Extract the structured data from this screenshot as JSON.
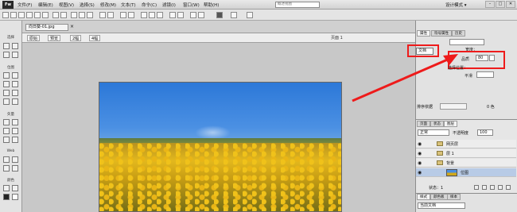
{
  "menubar": {
    "logo": "Fw",
    "items": [
      "文件(F)",
      "编辑(E)",
      "视图(V)",
      "选择(S)",
      "修改(M)",
      "文本(T)",
      "命令(C)",
      "滤镜(I)",
      "窗口(W)",
      "帮助(H)"
    ],
    "search_placeholder": "概述视图",
    "mode": "设计模式 ▾",
    "window_buttons": [
      "–",
      "□",
      "✕"
    ]
  },
  "document": {
    "tab_title": "向日葵-01.jpg",
    "tab_close": "×",
    "view_buttons": [
      "原始",
      "预览",
      "2幅",
      "4幅"
    ],
    "scene": "页面 1"
  },
  "tools": {
    "sections": [
      "选择",
      "位图",
      "矢量",
      "Web",
      "颜色"
    ]
  },
  "properties": {
    "tabs": [
      "属性",
      "符号属性",
      "历史"
    ],
    "doc_label": "文档",
    "width_label": "宽度：",
    "frame_label": "品质",
    "frame_value": "80",
    "fill_label": "平滑",
    "extra_label": "选择位置：",
    "sort_label": "排序依据",
    "color_label": "0 色"
  },
  "layers": {
    "tabs": [
      "页面",
      "状态",
      "图层"
    ],
    "blend_mode": "正常",
    "opacity_label": "不透明度",
    "opacity_value": "100",
    "rows": [
      {
        "name": "网页层",
        "type": "folder"
      },
      {
        "name": "层 1",
        "type": "folder"
      },
      {
        "name": "背景",
        "type": "folder"
      },
      {
        "name": "位图",
        "type": "bitmap"
      }
    ],
    "state_label": "状态：1"
  },
  "library": {
    "tabs": [
      "样式",
      "颜色板",
      "样本"
    ],
    "select_value": "当前文档"
  },
  "colors": {
    "highlight": "#ee1b1b",
    "selected_row": "#b8cbe6"
  }
}
